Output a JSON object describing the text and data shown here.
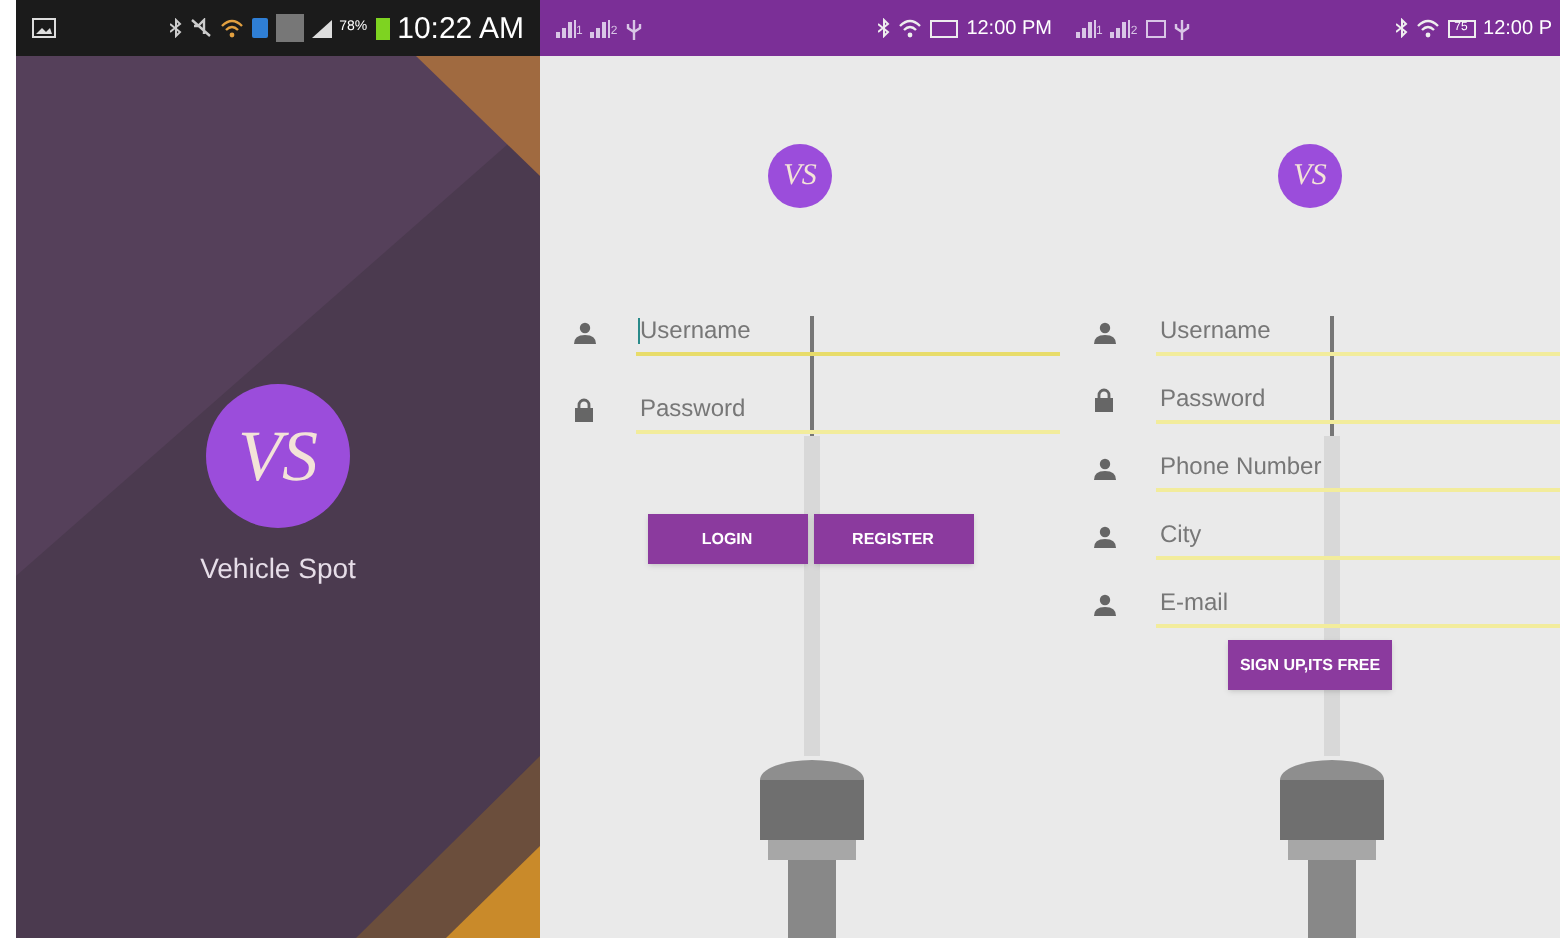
{
  "screens": [
    {
      "kind": "splash",
      "status_bar": {
        "kind": "dark",
        "battery_text": "78%",
        "time": "10:22 AM"
      },
      "logo_text": "VS",
      "app_name": "Vehicle Spot"
    },
    {
      "kind": "login",
      "status_bar": {
        "kind": "purple",
        "sims": [
          "1",
          "2"
        ],
        "time": "12:00 PM"
      },
      "logo_text": "VS",
      "fields": [
        {
          "kind": "user",
          "placeholder": "Username",
          "focused": true
        },
        {
          "kind": "lock",
          "placeholder": "Password",
          "focused": false
        }
      ],
      "buttons": [
        "LOGIN",
        "REGISTER"
      ]
    },
    {
      "kind": "signup",
      "status_bar": {
        "kind": "purple",
        "sims": [
          "1",
          "2"
        ],
        "battery_text": "75",
        "time": "12:00 P"
      },
      "logo_text": "VS",
      "fields": [
        {
          "kind": "user",
          "placeholder": "Username",
          "focused": false
        },
        {
          "kind": "lock",
          "placeholder": "Password",
          "focused": false
        },
        {
          "kind": "user",
          "placeholder": "Phone Number",
          "focused": false
        },
        {
          "kind": "user",
          "placeholder": "City",
          "focused": false
        },
        {
          "kind": "user",
          "placeholder": "E-mail",
          "focused": false
        }
      ],
      "buttons": [
        "SIGN UP,ITS FREE"
      ]
    }
  ]
}
